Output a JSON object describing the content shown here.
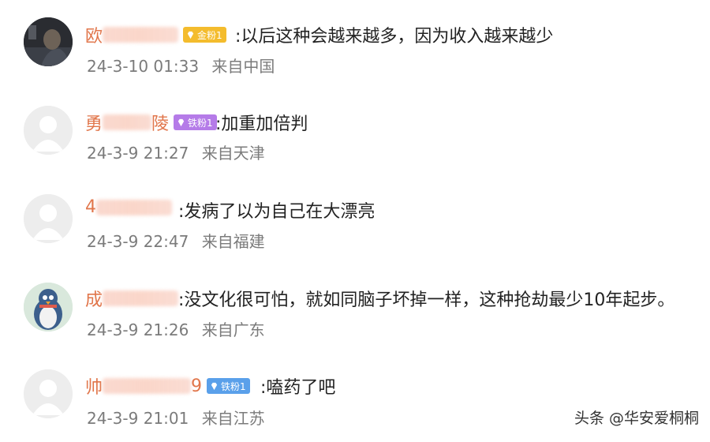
{
  "comments": [
    {
      "name_visible": "欧",
      "name_tail": "",
      "badge": "金粉1",
      "text": ":以后这种会越来越多，因为收入越来越少",
      "date": "24-3-10 01:33",
      "location": "来自中国"
    },
    {
      "name_visible": "勇",
      "name_tail": "陵",
      "badge": "铁粉1",
      "text": ":加重加倍判",
      "date": "24-3-9 21:27",
      "location": "来自天津"
    },
    {
      "name_visible": "4",
      "name_tail": "",
      "badge": "",
      "text": ":发病了以为自己在大漂亮",
      "date": "24-3-9 22:47",
      "location": "来自福建"
    },
    {
      "name_visible": "成",
      "name_tail": "",
      "badge": "",
      "text": ":没文化很可怕，就如同脑子坏掉一样，这种抢劫最少10年起步。",
      "date": "24-3-9 21:26",
      "location": "来自广东"
    },
    {
      "name_visible": "帅",
      "name_tail": "9",
      "badge": "铁粉1",
      "text": ":嗑药了吧",
      "date": "24-3-9 21:01",
      "location": "来自江苏"
    }
  ],
  "watermark": "头条 @华安爱桐桐",
  "colors": {
    "name": "#e1764b",
    "text": "#222222",
    "meta": "#7b7b7b",
    "badge_gold": "#f4bc2d",
    "badge_purple": "#b57be8",
    "badge_blue": "#5aa0ea"
  }
}
